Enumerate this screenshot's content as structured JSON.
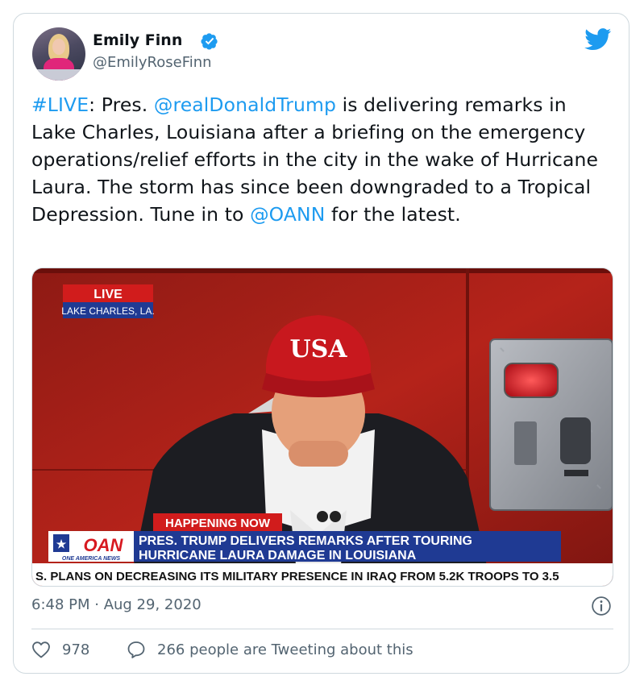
{
  "author": {
    "name": "Emily Finn",
    "handle": "@EmilyRoseFinn"
  },
  "tweet": {
    "parts": [
      {
        "text": "#LIVE",
        "link": true
      },
      {
        "text": ": Pres. ",
        "link": false
      },
      {
        "text": "@realDonaldTrump",
        "link": true
      },
      {
        "text": " is delivering remarks in Lake Charles, Louisiana after a briefing on the emergency operations/relief efforts in the city in the wake of Hurricane Laura. The storm has since been downgraded to a Tropical Depression. Tune in to ",
        "link": false
      },
      {
        "text": "@OANN",
        "link": true
      },
      {
        "text": " for the latest.",
        "link": false
      }
    ]
  },
  "media": {
    "live_label": "LIVE",
    "location": "LAKE CHARLES, LA.",
    "hat_text": "USA",
    "happening_label": "HAPPENING NOW",
    "network_logo": "OAN",
    "network_sub": "ONE AMERICA NEWS",
    "headline_line1": "PRES. TRUMP DELIVERS REMARKS AFTER TOURING",
    "headline_line2": "HURRICANE LAURA DAMAGE IN LOUISIANA",
    "ticker": "S. PLANS ON DECREASING ITS MILITARY PRESENCE IN IRAQ FROM 5.2K TROOPS TO 3.5"
  },
  "timestamp": "6:48 PM · Aug 29, 2020",
  "actions": {
    "likes": "978",
    "reply_text": "266 people are Tweeting about this"
  },
  "colors": {
    "accent": "#1d9bf0",
    "muted": "#536471",
    "like_red": "#f91880",
    "oan_red": "#d71920",
    "oan_blue": "#1f3a93"
  },
  "icons": [
    "verified-badge-icon",
    "twitter-bird-icon",
    "info-icon",
    "heart-icon",
    "speech-bubble-icon"
  ]
}
